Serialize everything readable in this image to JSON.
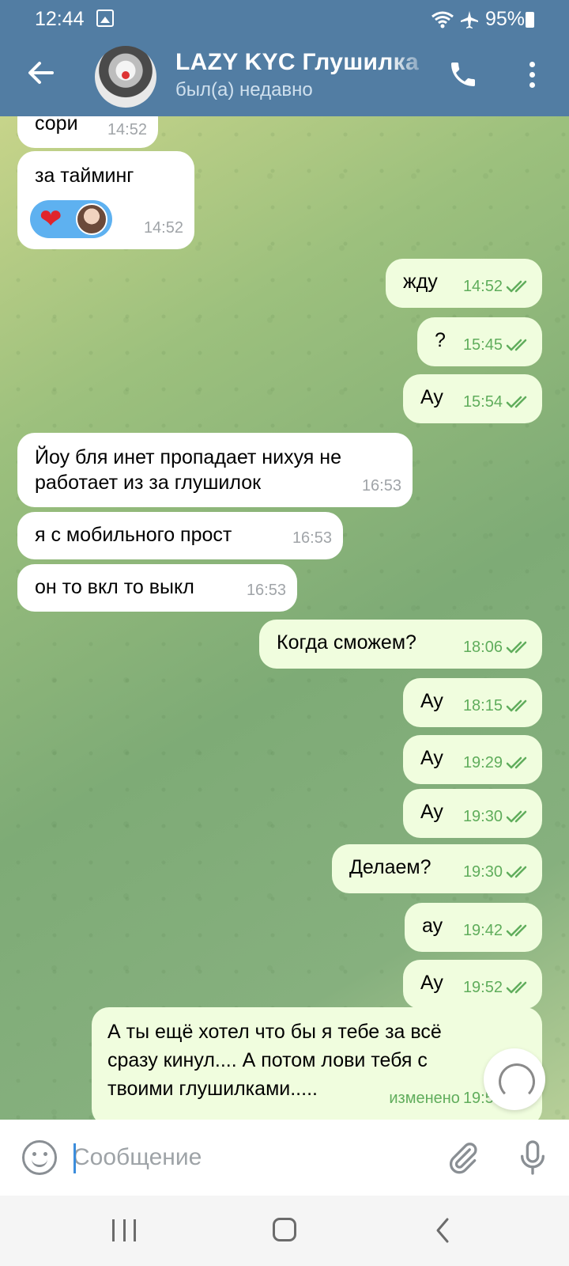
{
  "status_bar": {
    "time": "12:44",
    "battery": "95%"
  },
  "header": {
    "title": "LAZY KYC Глушилка",
    "subtitle": "был(а) недавно"
  },
  "messages": [
    {
      "dir": "in",
      "text": "сори",
      "time": "14:52"
    },
    {
      "dir": "in",
      "text": "за тайминг",
      "time": "14:52",
      "reaction": "❤"
    },
    {
      "dir": "out",
      "text": "жду",
      "time": "14:52"
    },
    {
      "dir": "out",
      "text": "?",
      "time": "15:45"
    },
    {
      "dir": "out",
      "text": "Ау",
      "time": "15:54"
    },
    {
      "dir": "in",
      "text": "Йоу бля инет пропадает нихуя не",
      "text2": "работает из за глушилок",
      "time": "16:53"
    },
    {
      "dir": "in",
      "text": "я с мобильного прост",
      "time": "16:53"
    },
    {
      "dir": "in",
      "text": "он то вкл то выкл",
      "time": "16:53"
    },
    {
      "dir": "out",
      "text": "Когда сможем?",
      "time": "18:06"
    },
    {
      "dir": "out",
      "text": "Ау",
      "time": "18:15"
    },
    {
      "dir": "out",
      "text": "Ау",
      "time": "19:29"
    },
    {
      "dir": "out",
      "text": "Ау",
      "time": "19:30"
    },
    {
      "dir": "out",
      "text": "Делаем?",
      "time": "19:30"
    },
    {
      "dir": "out",
      "text": "ау",
      "time": "19:42"
    },
    {
      "dir": "out",
      "text": "Ау",
      "time": "19:52"
    },
    {
      "dir": "out",
      "text": "А ты ещё хотел что бы я тебе за всё",
      "text2": "сразу кинул.... А потом лови тебя с",
      "text3": "твоими глушилками.....",
      "time": "19:53",
      "edited": "изменено"
    }
  ],
  "input": {
    "placeholder": "Сообщение"
  },
  "colors": {
    "header": "#527da3",
    "outgoing_bubble": "#f0fdde",
    "incoming_bubble": "#ffffff",
    "check": "#60ad5c",
    "reaction": "#5eb1f0"
  }
}
